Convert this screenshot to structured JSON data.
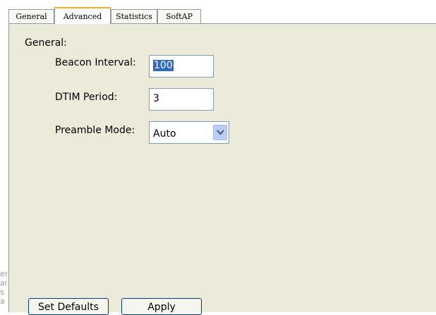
{
  "tabs": [
    {
      "label": "General"
    },
    {
      "label": "Advanced"
    },
    {
      "label": "Statistics"
    },
    {
      "label": "SoftAP"
    }
  ],
  "active_tab": "Advanced",
  "section_title": "General:",
  "beacon_interval": {
    "label": "Beacon Interval:",
    "value": "100"
  },
  "dtim_period": {
    "label": "DTIM Period:",
    "value": "3"
  },
  "preamble_mode": {
    "label": "Preamble Mode:",
    "value": "Auto"
  },
  "buttons": {
    "set_defaults": "Set Defaults",
    "apply": "Apply"
  },
  "behind_text": [
    "es",
    "an",
    "s a"
  ],
  "colors": {
    "panel_bg": "#ecead9",
    "tab_accent": "#f5a930",
    "selection": "#316ac5"
  }
}
